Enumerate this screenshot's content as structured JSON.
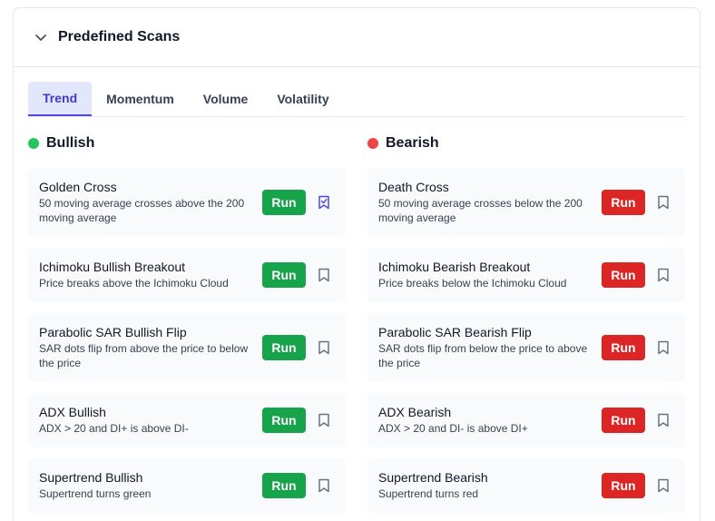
{
  "header": {
    "title": "Predefined Scans"
  },
  "tabs": [
    {
      "label": "Trend"
    },
    {
      "label": "Momentum"
    },
    {
      "label": "Volume"
    },
    {
      "label": "Volatility"
    }
  ],
  "bullish": {
    "title": "Bullish",
    "items": [
      {
        "title": "Golden Cross",
        "desc": "50 moving average crosses above the 200 moving average",
        "run": "Run"
      },
      {
        "title": "Ichimoku Bullish Breakout",
        "desc": "Price breaks above the Ichimoku Cloud",
        "run": "Run"
      },
      {
        "title": "Parabolic SAR Bullish Flip",
        "desc": "SAR dots flip from above the price to below the price",
        "run": "Run"
      },
      {
        "title": "ADX Bullish",
        "desc": "ADX > 20 and DI+ is above DI-",
        "run": "Run"
      },
      {
        "title": "Supertrend Bullish",
        "desc": "Supertrend turns green",
        "run": "Run"
      }
    ]
  },
  "bearish": {
    "title": "Bearish",
    "items": [
      {
        "title": "Death Cross",
        "desc": "50 moving average crosses below the 200 moving average",
        "run": "Run"
      },
      {
        "title": "Ichimoku Bearish Breakout",
        "desc": "Price breaks below the Ichimoku Cloud",
        "run": "Run"
      },
      {
        "title": "Parabolic SAR Bearish Flip",
        "desc": "SAR dots flip from below the price to above the price",
        "run": "Run"
      },
      {
        "title": "ADX Bearish",
        "desc": "ADX > 20 and DI- is above DI+",
        "run": "Run"
      },
      {
        "title": "Supertrend Bearish",
        "desc": "Supertrend turns red",
        "run": "Run"
      }
    ]
  },
  "colors": {
    "accent": "#4f46e5",
    "bullish": "#22c55e",
    "bearish": "#ef4444",
    "run_green": "#16a34a",
    "run_red": "#dc2626"
  }
}
